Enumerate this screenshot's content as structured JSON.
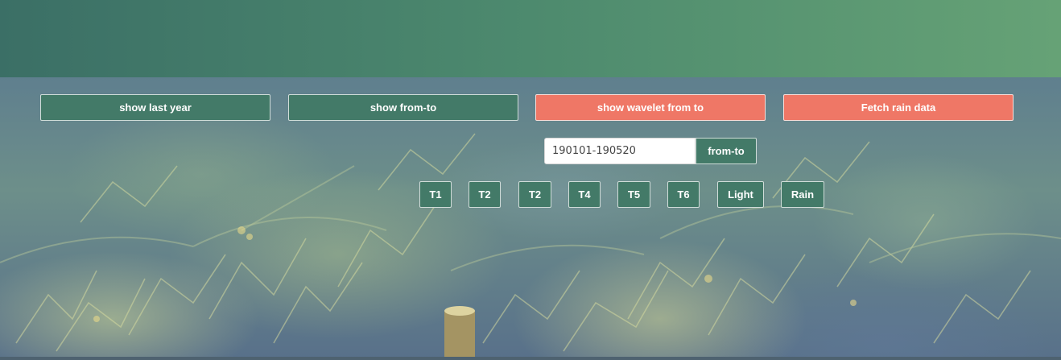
{
  "header": {
    "gradient_start": "#3b6f66",
    "gradient_end": "#66a276"
  },
  "background": {
    "description_icon": "underwater-seaweed-image"
  },
  "actions": {
    "show_last_year": "show last year",
    "show_from_to": "show from-to",
    "show_wavelet": "show wavelet from to",
    "fetch_rain": "Fetch rain data"
  },
  "range": {
    "value": "190101-190520",
    "button_label": "from-to"
  },
  "series_buttons": [
    "T1",
    "T2",
    "T2",
    "T4",
    "T5",
    "T6",
    "Light",
    "Rain"
  ],
  "colors": {
    "primary_green": "#437a68",
    "accent_red": "#ef7766"
  }
}
